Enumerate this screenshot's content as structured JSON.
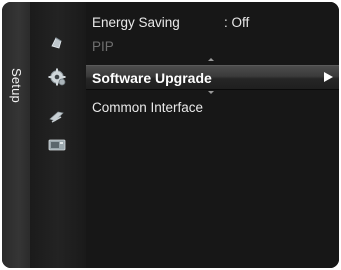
{
  "sidebar": {
    "title": "Setup",
    "icons": [
      {
        "name": "picture-icon"
      },
      {
        "name": "sound-icon"
      },
      {
        "name": "setup-gear-icon"
      },
      {
        "name": "input-icon"
      },
      {
        "name": "application-icon"
      }
    ]
  },
  "menu": {
    "items": [
      {
        "label": "Energy Saving",
        "value": ": Off"
      },
      {
        "label": "PIP",
        "value": ""
      },
      {
        "label": "Software Upgrade",
        "value": ""
      },
      {
        "label": "Common Interface",
        "value": ""
      }
    ],
    "selected_index": 2
  },
  "colors": {
    "highlight": "#3a3a3a",
    "text": "#e9e9e9",
    "disabled_text": "#6f6f6f",
    "background": "#171717"
  }
}
